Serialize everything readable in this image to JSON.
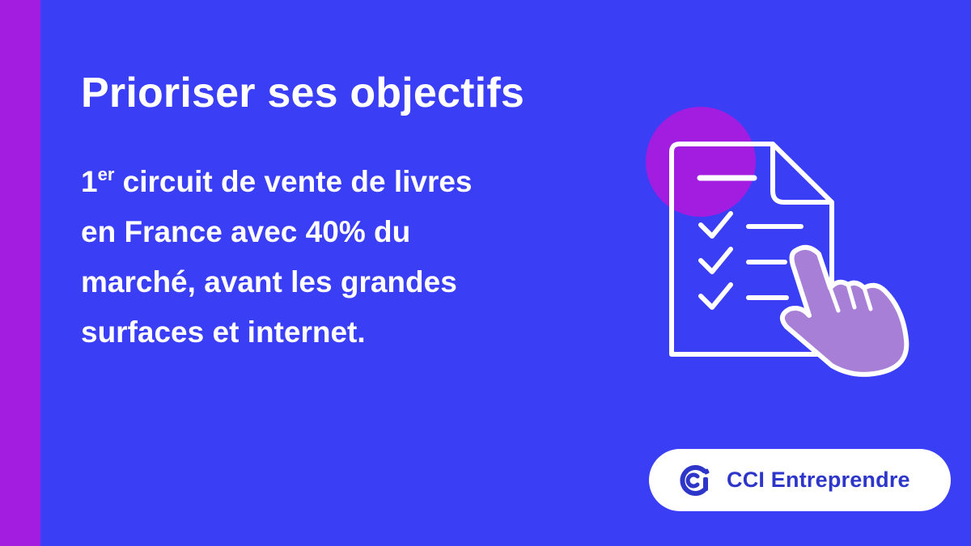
{
  "title": "Prioriser ses objectifs",
  "body": {
    "ordinal_number": "1",
    "ordinal_suffix": "er",
    "line1_rest": " circuit de vente de livres",
    "line2": "en France avec 40% du",
    "line3": "marché, avant les grandes",
    "line4": "surfaces et internet."
  },
  "brand": {
    "name": "CCI Entreprendre",
    "logo_icon": "cci-logo-icon"
  },
  "illustration": {
    "icon": "checklist-document-with-pointing-hand-icon",
    "checked_items": 3
  },
  "colors": {
    "background": "#3a3ef5",
    "side_bar": "#a31de0",
    "accent_circle": "#a31de0",
    "hand_fill": "#a77fd6",
    "brand_text": "#2d36c9",
    "text": "#ffffff"
  }
}
